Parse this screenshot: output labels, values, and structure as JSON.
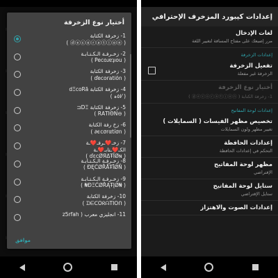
{
  "left": {
    "dialog_title": "أختيار نوع الزخرفة",
    "options": [
      {
        "label": "1- زخرفة الكتابة\n( ⓓⓔⓒⓞⓡⓐⓣⓘⓞⓝ )",
        "selected": true
      },
      {
        "label": "2- زخـرفـة الـكـتـابـة\n( Pecoɹɐʇıou )",
        "selected": false
      },
      {
        "label": "3- زخرفة الكتابة\n( ďecoratiön )",
        "selected": false
      },
      {
        "label": "4- زخرفة الكتابة dΞcoRã\n( ⁄ا٥ہ )",
        "selected": false
      },
      {
        "label": "5- زخرفة الكتابة DΞ⊏\n( ⊖RΑTIΘN )",
        "selected": false
      },
      {
        "label": "6- زخ رفة الكتابة\n( ϵcσrαtíσn∂ )",
        "selected": false
      },
      {
        "label": "7- زخـ❤️ـرفـ❤️ـة\nالكـ❤️ـتابـ❤️ـة\n( ɗɛcØЯΔŦÎØɴ )",
        "selected": false
      },
      {
        "label": "8- زخـرفـة الـكـتـابـة\n( ĐĘĆØŘÅŦĪØŇ )",
        "selected": false
      },
      {
        "label": "9- زخـرفـة الـكـتـابـة\n( ₦ĐΞĆØŘĄŦĮØ₦ )",
        "selected": false
      },
      {
        "label": "10- زخرفة الكتابة\n( ᗪᗴᑕOᖇᗩTIOᑎ )",
        "selected": false
      },
      {
        "label": "11- انجليزي معرب ( z5rfah",
        "selected": false
      }
    ],
    "ok_button": "موافق"
  },
  "right": {
    "title": "إعدادات كيبورد المزخرف الإحترافي",
    "items": [
      {
        "type": "pref",
        "title": "لغات الإدخال",
        "summary": "مرر إصبعك على مفتاح المسافة لتغيير اللغة"
      },
      {
        "type": "category",
        "title": "إعدادات الزخرفة"
      },
      {
        "type": "pref-check",
        "title": "تفعيل الزخرفة",
        "summary": "الزخرفة غير مفعلة",
        "checked": false
      },
      {
        "type": "pref-disabled",
        "title": "أختيار نوع الزخرفة",
        "summary": "1- زخرفة الكتابة ( ⓓⓔⓒⓞⓡⓐⓣⓘⓞⓝ )"
      },
      {
        "type": "category",
        "title": "إعدادات لوحة المفاتيح"
      },
      {
        "type": "pref",
        "title": "تخصيص مظهر الفيسات ( السمايلات )",
        "summary": "تغيير مظهر ولون السمايلات"
      },
      {
        "type": "pref",
        "title": "إعدادات الحافظة",
        "summary": "التحكم في إعدادات الحافظة"
      },
      {
        "type": "pref",
        "title": "مظهر لوحة المفاتيح",
        "summary": "الإفتراضي"
      },
      {
        "type": "pref",
        "title": "ستايل لوحة المفاتيح",
        "summary": "ستايل الإفتراضي"
      },
      {
        "type": "pref",
        "title": "إعدادات الصوت والاهتزاز",
        "summary": ""
      }
    ]
  },
  "colors": {
    "accent": "#2fa5ad",
    "surface": "#1b1b1b",
    "dialog": "#424242"
  }
}
